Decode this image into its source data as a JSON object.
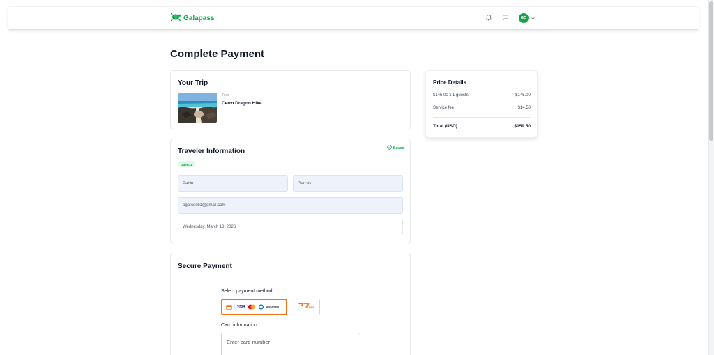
{
  "nav": {
    "brand": "Galapass",
    "avatar_initials": "GO",
    "icons": [
      "bell-icon",
      "chat-icon",
      "chevron-down-icon"
    ]
  },
  "page": {
    "title": "Complete Payment"
  },
  "trip": {
    "title": "Your Trip",
    "type_label": "Tour",
    "name": "Cerro Dragon Hike"
  },
  "traveler": {
    "title": "Traveler Information",
    "saved_label": "Saved",
    "guest_badge": "Guest 1",
    "first_name": "Pablo",
    "last_name": "Garces",
    "email": "pgarcesb1@gmail.com",
    "date": "Wednesday, March 18, 2026"
  },
  "payment": {
    "title": "Secure Payment",
    "select_method_label": "Select payment method",
    "card_brands": [
      "VISA",
      "Mastercard",
      "Diners Club",
      "DISCOVER"
    ],
    "alt_method_logo": "PPP",
    "card_info_label": "Card information",
    "card_number_placeholder": "Enter card number"
  },
  "price": {
    "title": "Price Details",
    "rows": [
      {
        "label": "$145.00 x 1 guests",
        "value": "$145.00"
      },
      {
        "label": "Service fee",
        "value": "$14.50"
      }
    ],
    "total_label": "Total (USD)",
    "total_value": "$159.50"
  },
  "colors": {
    "brand_green": "#16a34a",
    "accent_orange": "#f97316",
    "field_bg": "#edf2fb"
  }
}
